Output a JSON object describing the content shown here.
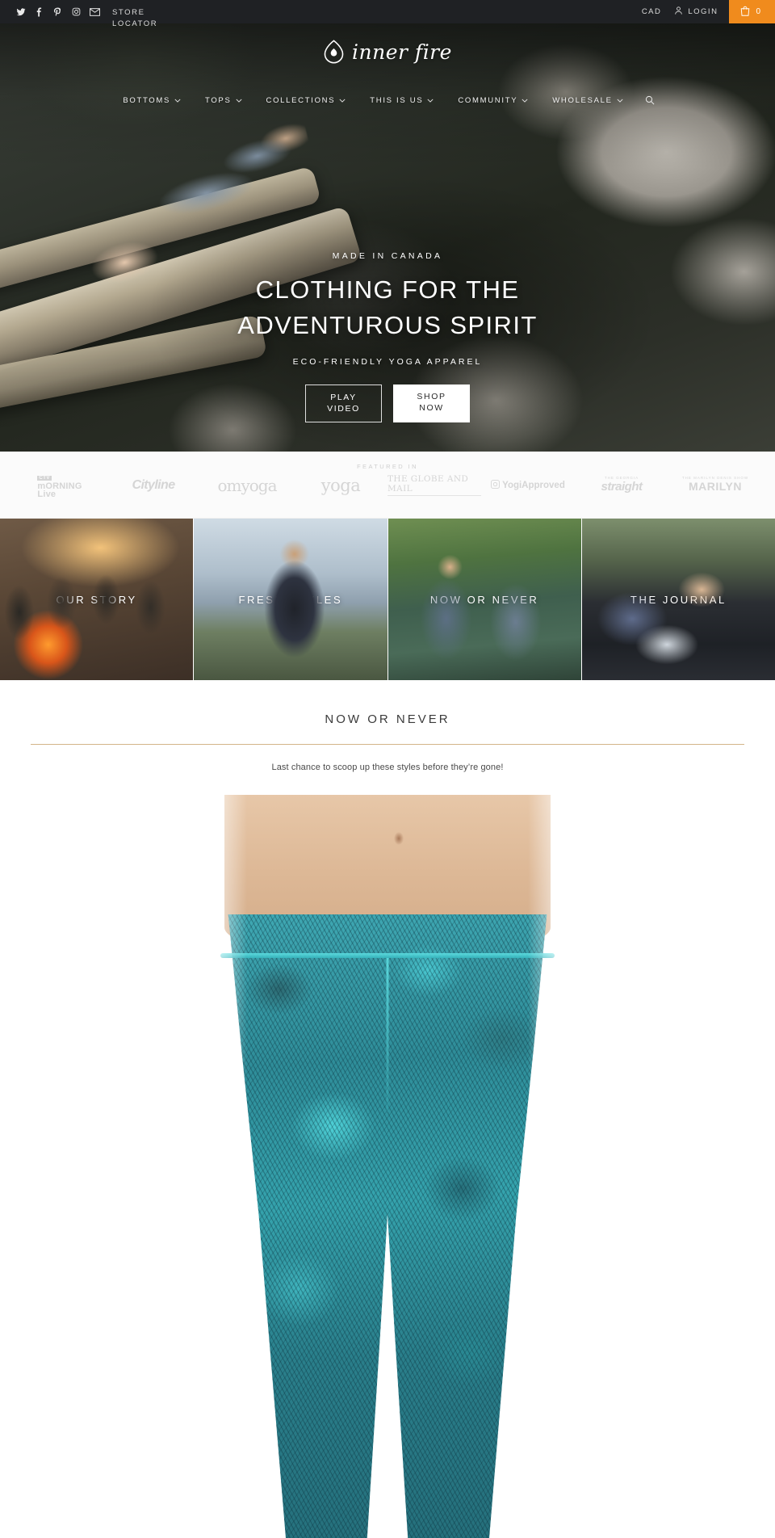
{
  "topbar": {
    "social": [
      {
        "name": "twitter-icon",
        "label": "Twitter"
      },
      {
        "name": "facebook-icon",
        "label": "Facebook"
      },
      {
        "name": "pinterest-icon",
        "label": "Pinterest"
      },
      {
        "name": "instagram-icon",
        "label": "Instagram"
      },
      {
        "name": "email-icon",
        "label": "Email"
      }
    ],
    "store_locator": "STORE LOCATOR",
    "currency": "CAD",
    "login": "LOGIN",
    "cart_count": "0",
    "cart_accent_color": "#f08b1d",
    "background_color": "#1f2124"
  },
  "header": {
    "logo_text": "inner fire",
    "nav": [
      {
        "label": "BOTTOMS",
        "caret": true
      },
      {
        "label": "TOPS",
        "caret": true
      },
      {
        "label": "COLLECTIONS",
        "caret": true
      },
      {
        "label": "THIS IS US",
        "caret": true
      },
      {
        "label": "COMMUNITY",
        "caret": true
      },
      {
        "label": "WHOLESALE",
        "caret": true
      }
    ],
    "search_icon": "search-icon"
  },
  "hero": {
    "eyebrow": "MADE IN CANADA",
    "title_line1": "CLOTHING FOR THE",
    "title_line2": "ADVENTUROUS SPIRIT",
    "subtitle": "ECO-FRIENDLY YOGA APPAREL",
    "btn_play_line1": "PLAY",
    "btn_play_line2": "VIDEO",
    "btn_shop_line1": "SHOP",
    "btn_shop_line2": "NOW"
  },
  "featured": {
    "label": "FEATURED IN",
    "logos": [
      {
        "name": "ctv-morning-live-logo",
        "line1": "CTV",
        "line2": "mORNING",
        "line3": "Live"
      },
      {
        "name": "cityline-logo",
        "text": "Cityline"
      },
      {
        "name": "omyoga-logo",
        "text": "omyoga"
      },
      {
        "name": "yoga-logo",
        "text": "yoga"
      },
      {
        "name": "globe-and-mail-logo",
        "text": "THE GLOBE AND MAIL"
      },
      {
        "name": "yogiapproved-logo",
        "text": "YogiApproved"
      },
      {
        "name": "georgia-straight-logo",
        "text": "straight",
        "tiny": "THE GEORGIA"
      },
      {
        "name": "marilyn-logo",
        "text": "MARILYN",
        "tiny": "THE MARILYN DENIS SHOW"
      }
    ]
  },
  "tiles": [
    {
      "label": "OUR STORY",
      "name": "tile-our-story"
    },
    {
      "label": "FRESH STYLES",
      "name": "tile-fresh-styles"
    },
    {
      "label": "NOW OR NEVER",
      "name": "tile-now-or-never"
    },
    {
      "label": "THE JOURNAL",
      "name": "tile-the-journal"
    }
  ],
  "section": {
    "title": "NOW OR NEVER",
    "subtitle": "Last chance to scoop up these styles before they’re gone!",
    "rule_color": "#d3b489",
    "product_alt": "Teal floral print yoga capri leggings"
  }
}
